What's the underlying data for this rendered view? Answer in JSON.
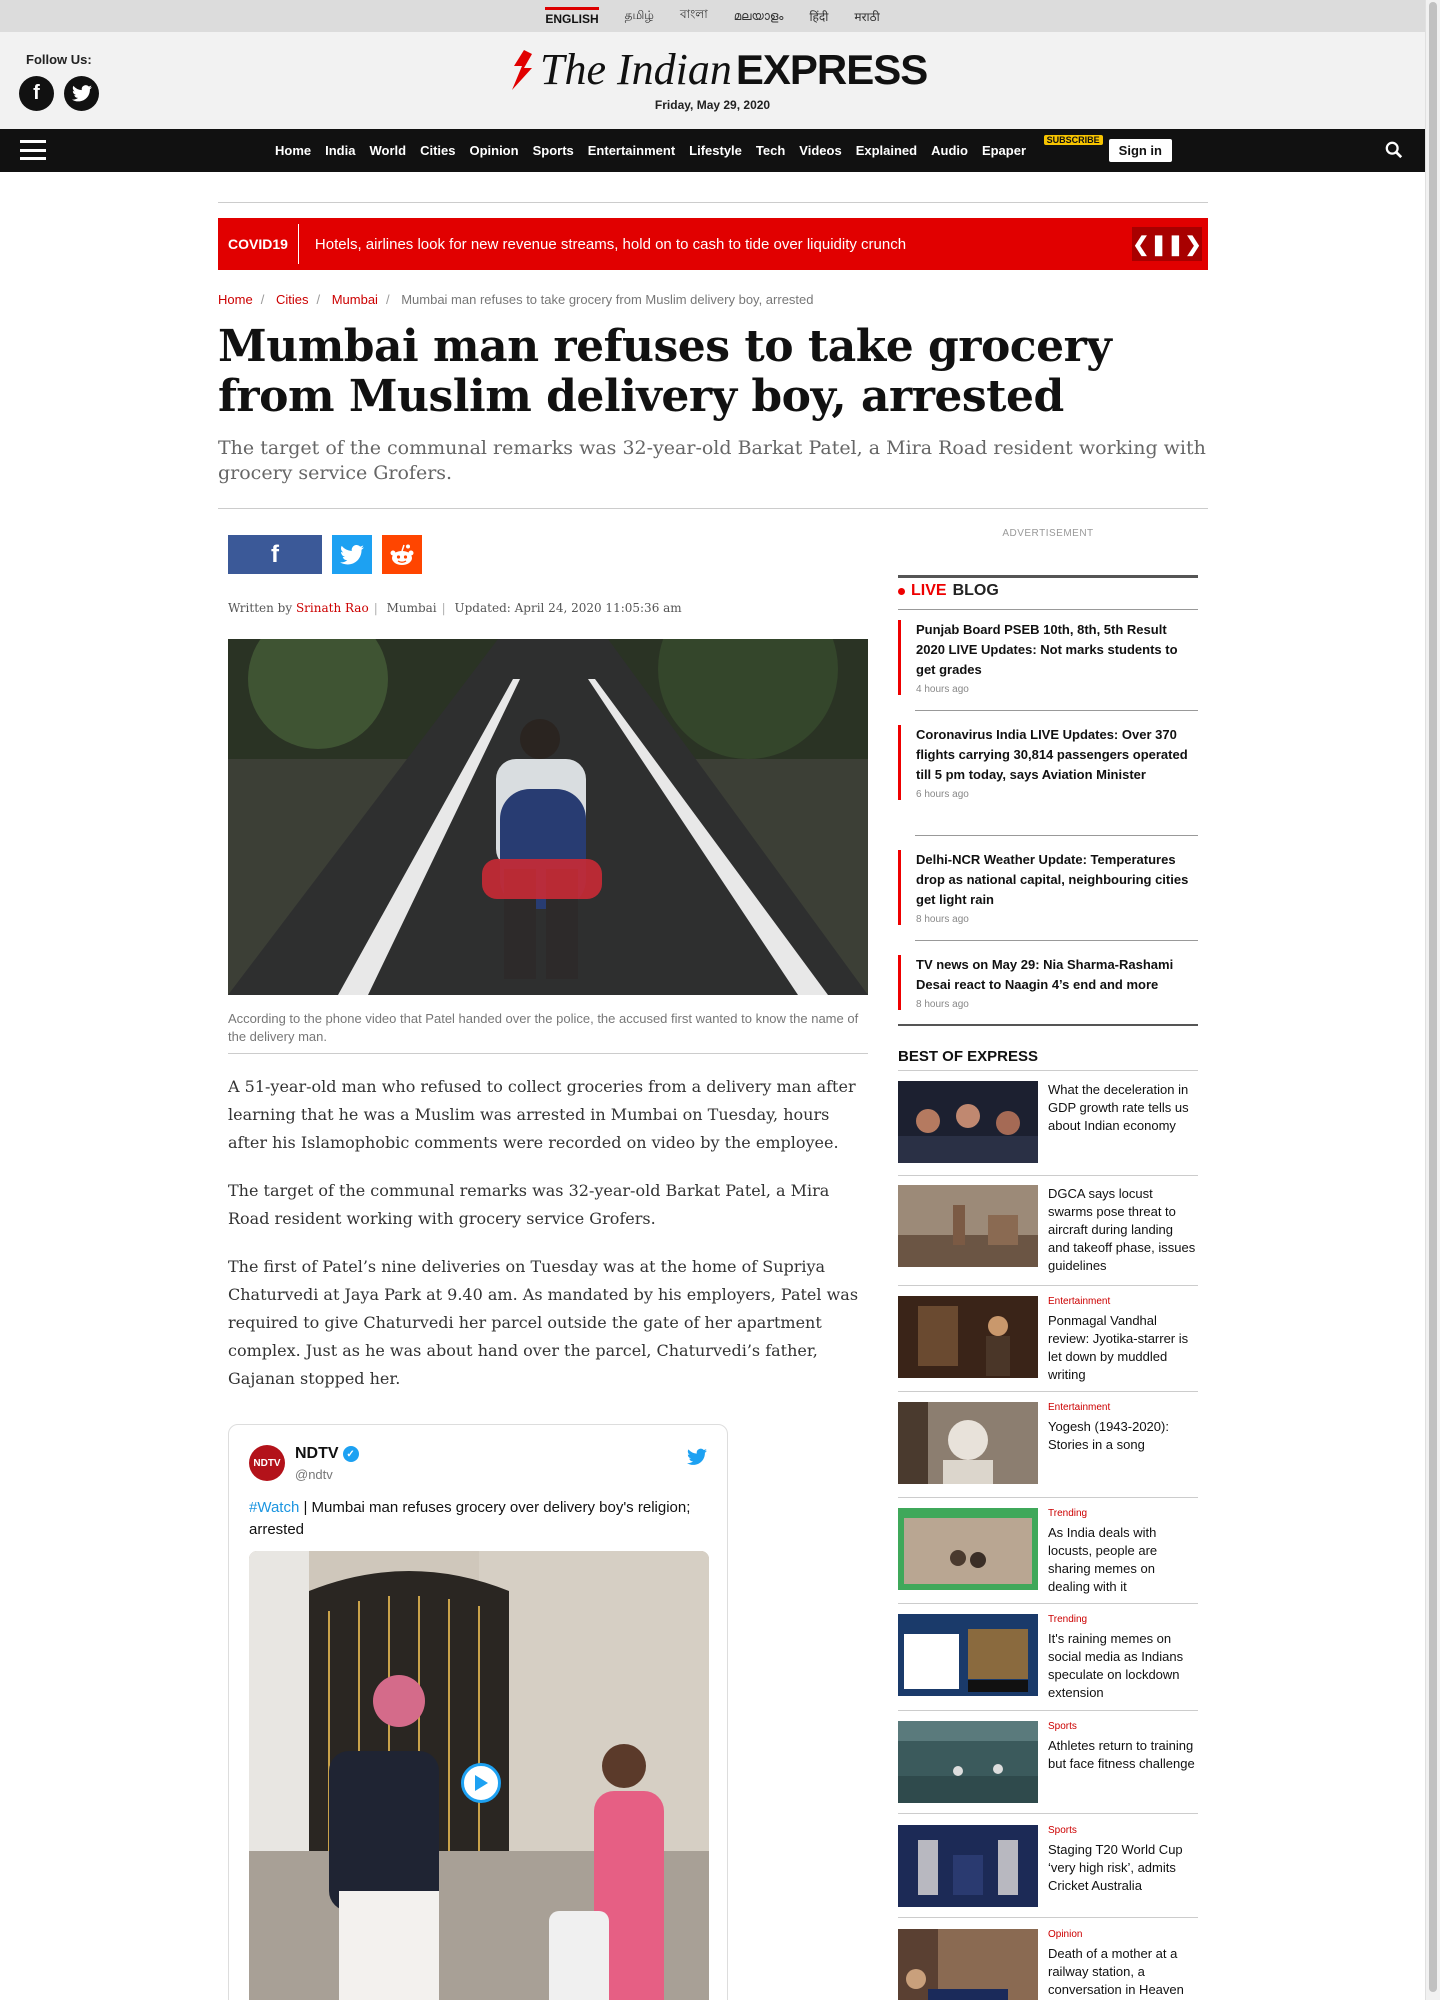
{
  "languages": [
    "ENGLISH",
    "தமிழ்",
    "বাংলা",
    "മലയാളം",
    "हिंदी",
    "मराठी"
  ],
  "masthead": {
    "follow_label": "Follow Us:",
    "logo_the": "The Indian",
    "logo_express": "EXPRESS",
    "date": "Friday, May 29, 2020"
  },
  "nav": {
    "items": [
      "Home",
      "India",
      "World",
      "Cities",
      "Opinion",
      "Sports",
      "Entertainment",
      "Lifestyle",
      "Tech",
      "Videos",
      "Explained",
      "Audio"
    ],
    "epaper": "Epaper",
    "subscribe": "SUBSCRIBE",
    "signin": "Sign in"
  },
  "ticker": {
    "tag": "COVID19",
    "headline": "Hotels, airlines look for new revenue streams, hold on to cash to tide over liquidity crunch"
  },
  "breadcrumb": [
    "Home",
    "Cities",
    "Mumbai",
    "Mumbai man refuses to take grocery from Muslim delivery boy, arrested"
  ],
  "article": {
    "title": "Mumbai man refuses to take grocery from Muslim delivery boy, arrested",
    "synopsis": "The target of the communal remarks was 32-year-old Barkat Patel, a Mira Road resident working with grocery service Grofers.",
    "byline_prefix": "Written by",
    "author": "Srinath Rao",
    "location": "Mumbai",
    "updated": "Updated: April 24, 2020 11:05:36 am",
    "caption": "According to the phone video that Patel handed over the police, the accused first wanted to know the name of the delivery man.",
    "paragraphs": [
      "A 51-year-old man who refused to collect groceries from a delivery man after learning that he was a Muslim was arrested in Mumbai on Tuesday, hours after his Islamophobic comments were recorded on video by the employee.",
      "The target of the communal remarks was 32-year-old Barkat Patel, a Mira Road resident working with grocery service Grofers.",
      "The first of Patel’s nine deliveries on Tuesday was at the home of Supriya Chaturvedi at Jaya Park at 9.40 am. As mandated by his employers, Patel was required to give Chaturvedi her parcel outside the gate of her apartment complex. Just as he was about hand over the parcel, Chaturvedi’s father, Gajanan stopped her."
    ]
  },
  "tweet": {
    "name": "NDTV",
    "handle": "@ndtv",
    "avatar_text": "NDTV",
    "hashtag": "#Watch",
    "text": " | Mumbai man refuses grocery over delivery boy's religion; arrested"
  },
  "sidebar": {
    "ad_label": "ADVERTISEMENT",
    "live_label": "LIVE",
    "blog_label": "BLOG",
    "live_items": [
      {
        "title": "Punjab Board PSEB 10th, 8th, 5th Result 2020 LIVE Updates: Not marks students to get grades",
        "time": "4 hours ago"
      },
      {
        "title": "Coronavirus India LIVE Updates: Over 370 flights carrying 30,814 passengers operated till 5 pm today, says Aviation Minister",
        "time": "6 hours ago"
      },
      {
        "title": "Delhi-NCR Weather Update: Temperatures drop as national capital, neighbouring cities get light rain",
        "time": "8 hours ago"
      },
      {
        "title": "TV news on May 29: Nia Sharma-Rashami Desai react to Naagin 4’s end and more",
        "time": "8 hours ago"
      }
    ],
    "best_title": "BEST OF EXPRESS",
    "best_items": [
      {
        "category": "",
        "title": "What the deceleration in GDP growth rate tells us about Indian economy"
      },
      {
        "category": "",
        "title": "DGCA says locust swarms pose threat to aircraft during landing and takeoff phase, issues guidelines"
      },
      {
        "category": "Entertainment",
        "title": "Ponmagal Vandhal review: Jyotika-starrer is let down by muddled writing"
      },
      {
        "category": "Entertainment",
        "title": "Yogesh (1943-2020): Stories in a song"
      },
      {
        "category": "Trending",
        "title": "As India deals with locusts, people are sharing memes on dealing with it"
      },
      {
        "category": "Trending",
        "title": "It's raining memes on social media as Indians speculate on lockdown extension"
      },
      {
        "category": "Sports",
        "title": "Athletes return to training but face fitness challenge"
      },
      {
        "category": "Sports",
        "title": "Staging T20 World Cup ‘very high risk’, admits Cricket Australia"
      },
      {
        "category": "Opinion",
        "title": "Death of a mother at a railway station, a conversation in Heaven"
      }
    ]
  },
  "colors": {
    "brand_red": "#e10000",
    "nav_bg": "#111111",
    "twitter_blue": "#1da1f2",
    "facebook_blue": "#3b5998",
    "reddit_orange": "#ff4500"
  }
}
